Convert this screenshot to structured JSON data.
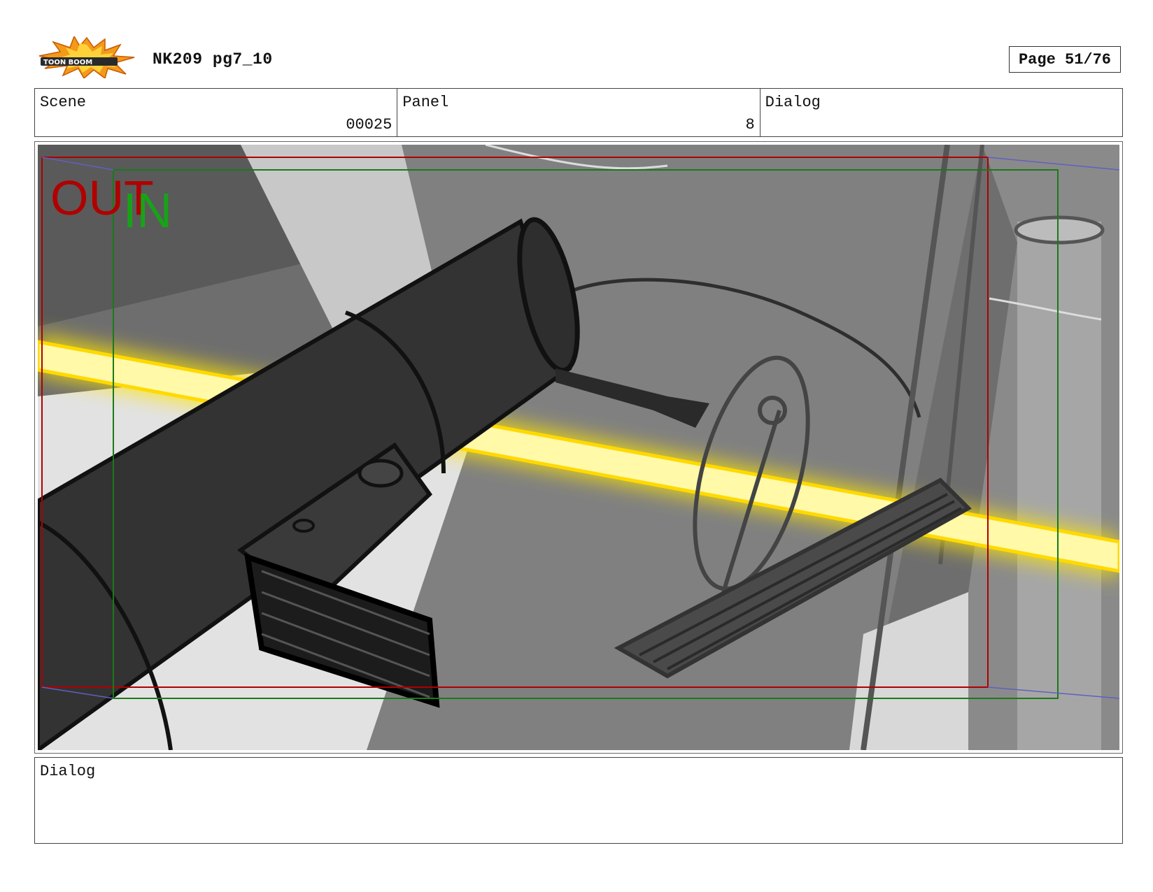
{
  "header": {
    "logo_text": "TOON BOOM",
    "logo_icon": "starburst-logo-icon",
    "title": "NK209 pg7_10",
    "page_label": "Page 51/76"
  },
  "info": {
    "scene_label": "Scene",
    "scene_value": "00025",
    "panel_label": "Panel",
    "panel_value": "8",
    "dialog_label": "Dialog"
  },
  "frame_marks": {
    "out_label": "OUT",
    "in_label": "IN",
    "out_color": "#b00000",
    "in_color": "#17a317"
  },
  "dialog": {
    "label": "Dialog"
  }
}
